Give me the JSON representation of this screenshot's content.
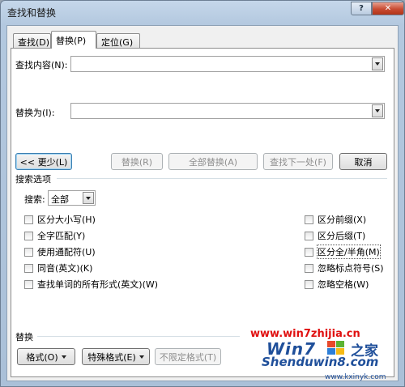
{
  "window": {
    "title": "查找和替换",
    "help": "?",
    "close": "✕"
  },
  "tabs": [
    {
      "label": "查找(D)"
    },
    {
      "label": "替换(P)"
    },
    {
      "label": "定位(G)"
    }
  ],
  "find": {
    "label": "查找内容(N):",
    "value": ""
  },
  "replace": {
    "label": "替换为(I):",
    "value": ""
  },
  "buttons": {
    "less": "<< 更少(L)",
    "replace": "替换(R)",
    "replace_all": "全部替换(A)",
    "find_next": "查找下一处(F)",
    "cancel": "取消"
  },
  "search_options": {
    "heading": "搜索选项",
    "direction_label": "搜索:",
    "direction_value": "全部",
    "left": [
      "区分大小写(H)",
      "全字匹配(Y)",
      "使用通配符(U)",
      "同音(英文)(K)",
      "查找单词的所有形式(英文)(W)"
    ],
    "right": [
      "区分前缀(X)",
      "区分后缀(T)",
      "区分全/半角(M)",
      "忽略标点符号(S)",
      "忽略空格(W)"
    ]
  },
  "replace_section": {
    "heading": "替换",
    "format": "格式(O)",
    "special": "特殊格式(E)",
    "no_format": "不限定格式(T)"
  },
  "watermark": {
    "url": "www.win7zhijia.cn",
    "logo": "Win7",
    "home": "之家",
    "brand": "Shenduwin8.com",
    "site": "www.kxinyk.com"
  },
  "colors": {
    "accent": "#1f4f9a",
    "watermark_red": "#e01010",
    "close": "#c84b32"
  }
}
